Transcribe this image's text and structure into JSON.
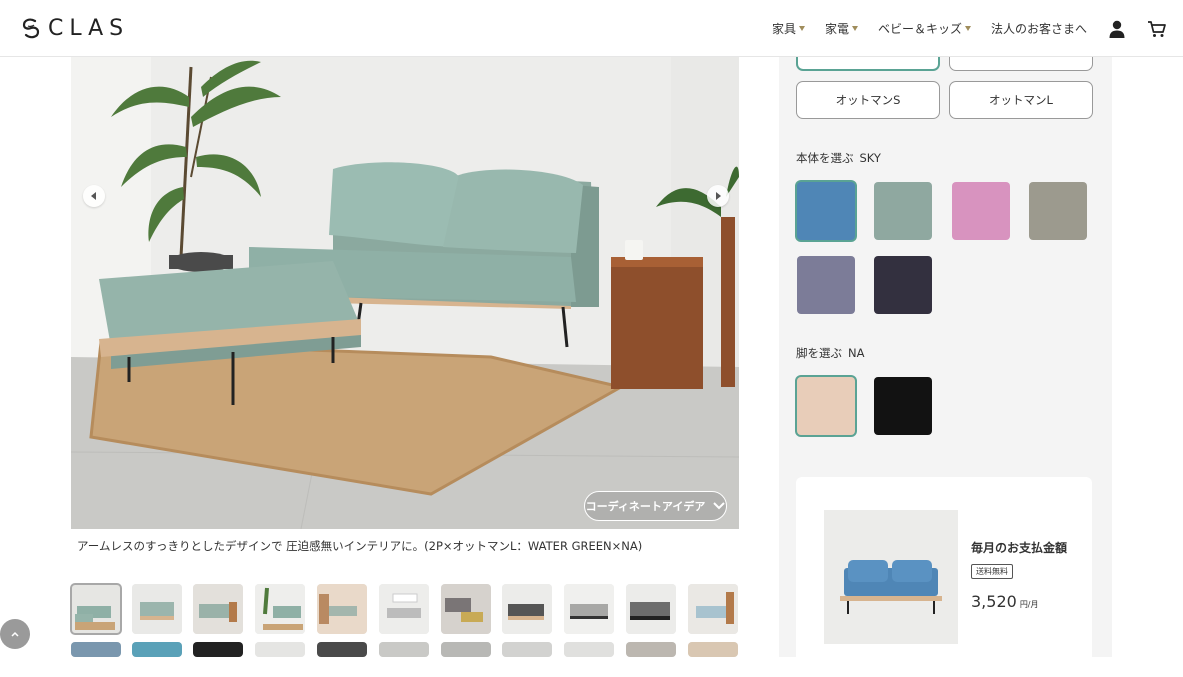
{
  "header": {
    "logo_text": "CLAS",
    "nav": [
      {
        "label": "家具",
        "dropdown": true
      },
      {
        "label": "家電",
        "dropdown": true
      },
      {
        "label": "ベビー＆キッズ",
        "dropdown": true
      },
      {
        "label": "法人のお客さまへ",
        "dropdown": false
      }
    ],
    "icons": [
      "account-icon",
      "cart-icon"
    ],
    "accent_caret_color": "#a08d5c"
  },
  "gallery": {
    "coordinate_button_label": "コーディネートアイデア",
    "caption": "アームレスのすっきりとしたデザインで 圧迫感無いインテリアに。(2P×オットマンL：WATER GREEN×NA)",
    "thumbnail_count_visible_row1": 11
  },
  "options": {
    "buttons": [
      {
        "label": "",
        "selected": true
      },
      {
        "label": "",
        "selected": false
      },
      {
        "label": "オットマンS",
        "selected": false
      },
      {
        "label": "オットマンL",
        "selected": false
      }
    ],
    "body": {
      "label": "本体を選ぶ",
      "value": "SKY",
      "swatches": [
        {
          "name": "sky",
          "color": "#4f86b6",
          "selected": true
        },
        {
          "name": "water-green",
          "color": "#8fa8a0",
          "selected": false
        },
        {
          "name": "pink",
          "color": "#d893bf",
          "selected": false
        },
        {
          "name": "beige-gray",
          "color": "#9c9a8e",
          "selected": false
        },
        {
          "name": "lavender-gray",
          "color": "#7c7c98",
          "selected": false
        },
        {
          "name": "navy",
          "color": "#33303f",
          "selected": false
        }
      ]
    },
    "legs": {
      "label": "脚を選ぶ",
      "value": "NA",
      "swatches": [
        {
          "name": "natural",
          "color": "#e8cdb9",
          "selected": true
        },
        {
          "name": "black",
          "color": "#121212",
          "selected": false
        }
      ]
    },
    "accent_color": "#5aa394"
  },
  "payment": {
    "title": "毎月のお支払金額",
    "badge": "送料無料",
    "price": "3,520",
    "unit": "円/月"
  }
}
